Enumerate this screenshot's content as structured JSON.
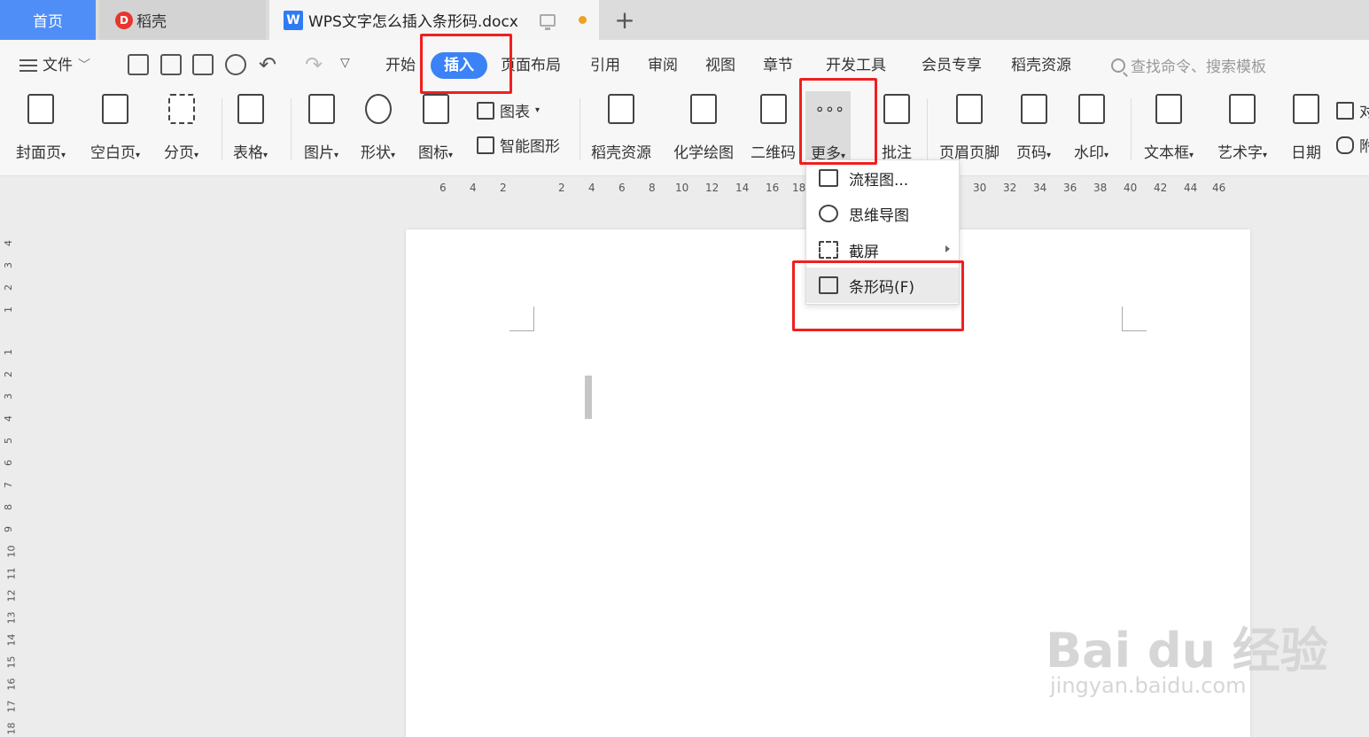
{
  "tabs": {
    "home": "首页",
    "daoke": "稻壳",
    "daoke_logo": "D",
    "doc_title": "WPS文字怎么插入条形码.docx",
    "doc_logo": "W",
    "add": "+"
  },
  "menu": {
    "file": "文件",
    "items": [
      "开始",
      "插入",
      "页面布局",
      "引用",
      "审阅",
      "视图",
      "章节",
      "开发工具",
      "会员专享",
      "稻壳资源"
    ],
    "search_placeholder": "查找命令、搜索模板"
  },
  "ribbon": {
    "cover": "封面页",
    "blank": "空白页",
    "pagebreak": "分页",
    "table": "表格",
    "picture": "图片",
    "shape": "形状",
    "icon": "图标",
    "chart": "图表",
    "smartart": "智能图形",
    "daoke_res": "稻壳资源",
    "chem": "化学绘图",
    "qrcode": "二维码",
    "more": "更多",
    "comment": "批注",
    "header_footer": "页眉页脚",
    "page_number": "页码",
    "watermark": "水印",
    "textbox": "文本框",
    "wordart": "艺术字",
    "date": "日期",
    "cut1": "对",
    "cut2": "附"
  },
  "dropdown": {
    "flowchart": "流程图...",
    "mindmap": "思维导图",
    "screenshot": "截屏",
    "barcode": "条形码(F)"
  },
  "ruler": {
    "h": [
      "6",
      "4",
      "2",
      "2",
      "4",
      "6",
      "8",
      "10",
      "12",
      "14",
      "16",
      "18",
      "30",
      "32",
      "34",
      "36",
      "38",
      "40",
      "42",
      "44",
      "46"
    ],
    "v": [
      "4",
      "3",
      "2",
      "1",
      "1",
      "2",
      "3",
      "4",
      "5",
      "6",
      "7",
      "8",
      "9",
      "10",
      "11",
      "12",
      "13",
      "14",
      "15",
      "16",
      "17",
      "18"
    ]
  },
  "watermark": {
    "main": "Bai du 经验",
    "sub": "jingyan.baidu.com"
  },
  "colors": {
    "accent": "#3b82f6",
    "home_tab": "#4f8ef7",
    "annotation_red": "#f01f1f"
  }
}
